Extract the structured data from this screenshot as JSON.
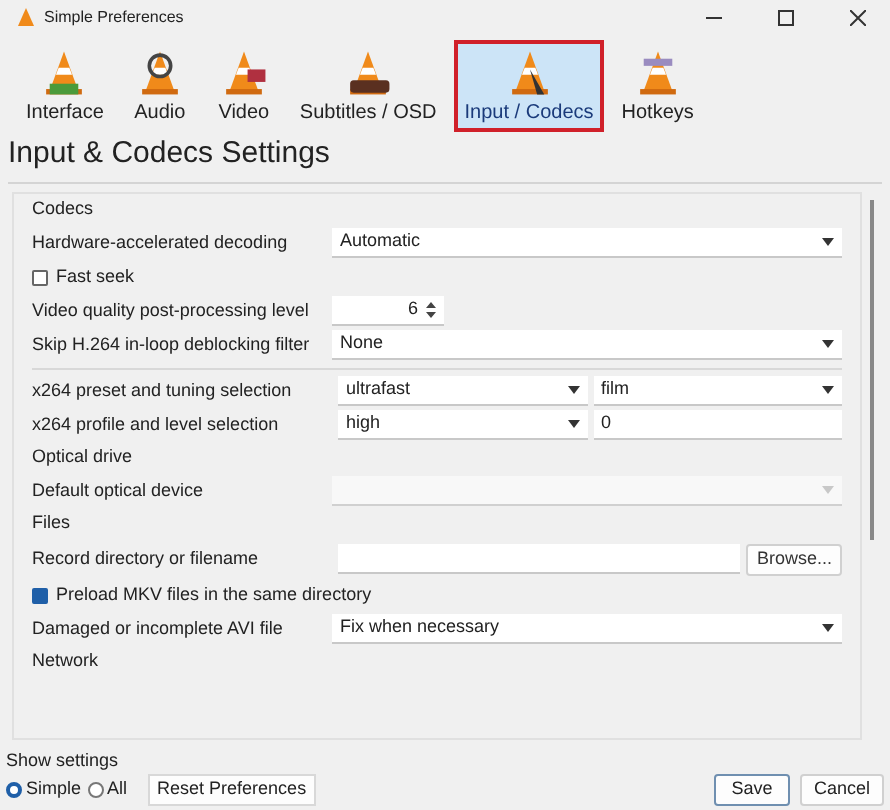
{
  "window": {
    "title": "Simple Preferences"
  },
  "tabs": [
    {
      "label": "Interface",
      "selected": false
    },
    {
      "label": "Audio",
      "selected": false
    },
    {
      "label": "Video",
      "selected": false
    },
    {
      "label": "Subtitles / OSD",
      "selected": false
    },
    {
      "label": "Input / Codecs",
      "selected": true
    },
    {
      "label": "Hotkeys",
      "selected": false
    }
  ],
  "heading": "Input & Codecs Settings",
  "sections": [
    {
      "title": "Codecs",
      "rows": [
        {
          "kind": "select",
          "label": "Hardware-accelerated decoding",
          "value": "Automatic",
          "disabled": false
        },
        {
          "kind": "checkbox",
          "label": "Fast seek",
          "checked": false
        },
        {
          "kind": "spin",
          "label": "Video quality post-processing level",
          "value": "6"
        },
        {
          "kind": "select",
          "label": "Skip H.264 in-loop deblocking filter",
          "value": "None",
          "disabled": false
        },
        {
          "kind": "divider"
        },
        {
          "kind": "select_pair",
          "label": "x264 preset and tuning selection",
          "value": "ultrafast",
          "value_2": "film"
        },
        {
          "kind": "select_text",
          "label": "x264 profile and level selection",
          "value": "high",
          "text": "0"
        }
      ]
    },
    {
      "title": "Optical drive",
      "rows": [
        {
          "kind": "select",
          "label": "Default optical device",
          "disabled": true
        }
      ]
    },
    {
      "title": "Files",
      "rows": [
        {
          "kind": "text_button",
          "label": "Record directory or filename",
          "button": "Browse..."
        },
        {
          "kind": "checkbox",
          "label": "Preload MKV files in the same directory",
          "checked": true
        },
        {
          "kind": "select",
          "label": "Damaged or incomplete AVI file",
          "value": "Fix when necessary",
          "disabled": false
        }
      ]
    },
    {
      "title": "Network"
    }
  ],
  "show_settings": {
    "label": "Show settings",
    "options": [
      {
        "label": "Simple",
        "selected": true
      },
      {
        "label": "All",
        "selected": false
      }
    ]
  },
  "buttons": {
    "reset": "Reset Preferences",
    "save": "Save",
    "cancel": "Cancel"
  }
}
